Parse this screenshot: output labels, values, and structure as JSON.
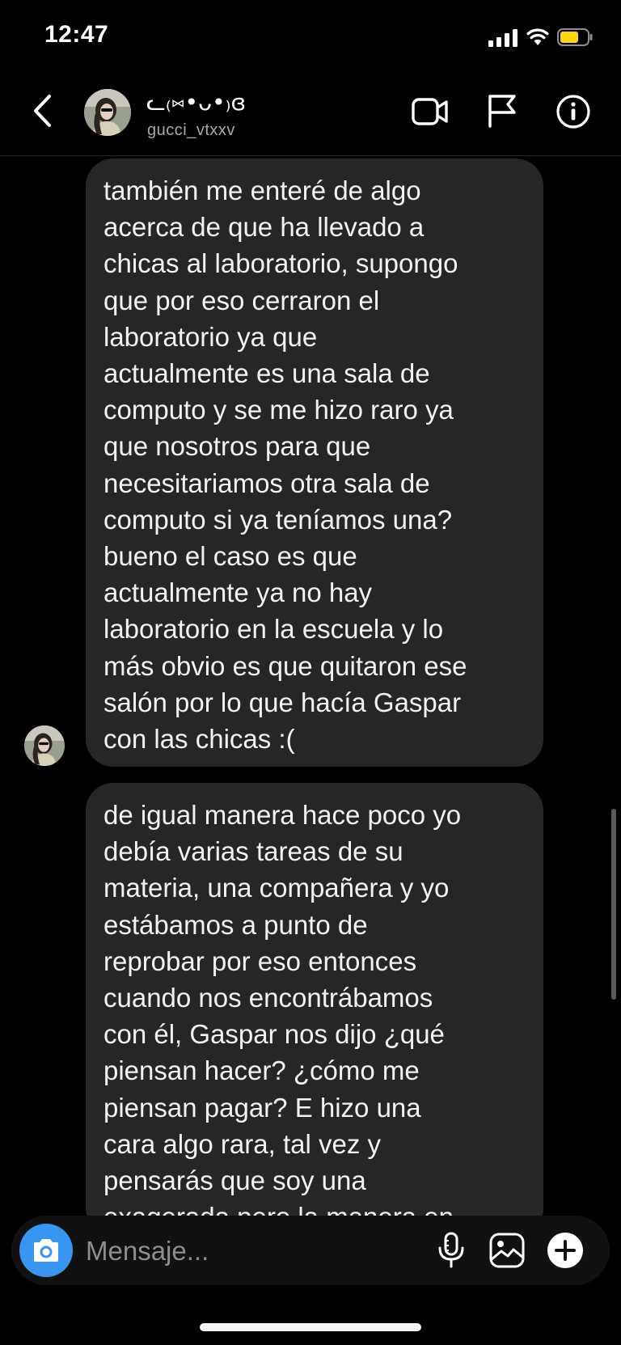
{
  "status_bar": {
    "time": "12:47"
  },
  "header": {
    "contact_name": "ᓚ₍⑅•ᴗ•₎ɞ",
    "contact_username": "gucci_vtxxv"
  },
  "messages": [
    {
      "text": "también me enteré de algo\nacerca de que ha llevado a\nchicas al laboratorio, supongo\nque por eso cerraron el\nlaboratorio ya que\nactualmente es una sala de\ncomputo y se me hizo raro ya\nque nosotros para que\nnecesitariamos otra sala de\ncomputo si ya teníamos una?\nbueno el caso es que\nactualmente ya no hay\nlaboratorio en la escuela y lo\nmás obvio es que quitaron ese\nsalón por lo que hacía Gaspar\ncon las chicas :("
    },
    {
      "text": "de igual manera hace poco yo\ndebía varias tareas de su\nmateria, una compañera y yo\nestábamos a punto de\nreprobar por eso entonces\ncuando nos encontrábamos\ncon él, Gaspar nos dijo ¿qué\npiensan hacer? ¿cómo me\npiensan pagar? E hizo una\ncara algo rara, tal vez y\npensarás que soy una\nexagerada pero la manera en"
    }
  ],
  "composer": {
    "placeholder": "Mensaje..."
  },
  "colors": {
    "background": "#000000",
    "bubble": "#262626",
    "camera_accent": "#3797f0",
    "battery_fill": "#ffd60a"
  },
  "icons": [
    "back-chevron-icon",
    "video-call-icon",
    "flag-icon",
    "info-icon",
    "camera-icon",
    "microphone-icon",
    "gallery-icon",
    "plus-icon"
  ]
}
